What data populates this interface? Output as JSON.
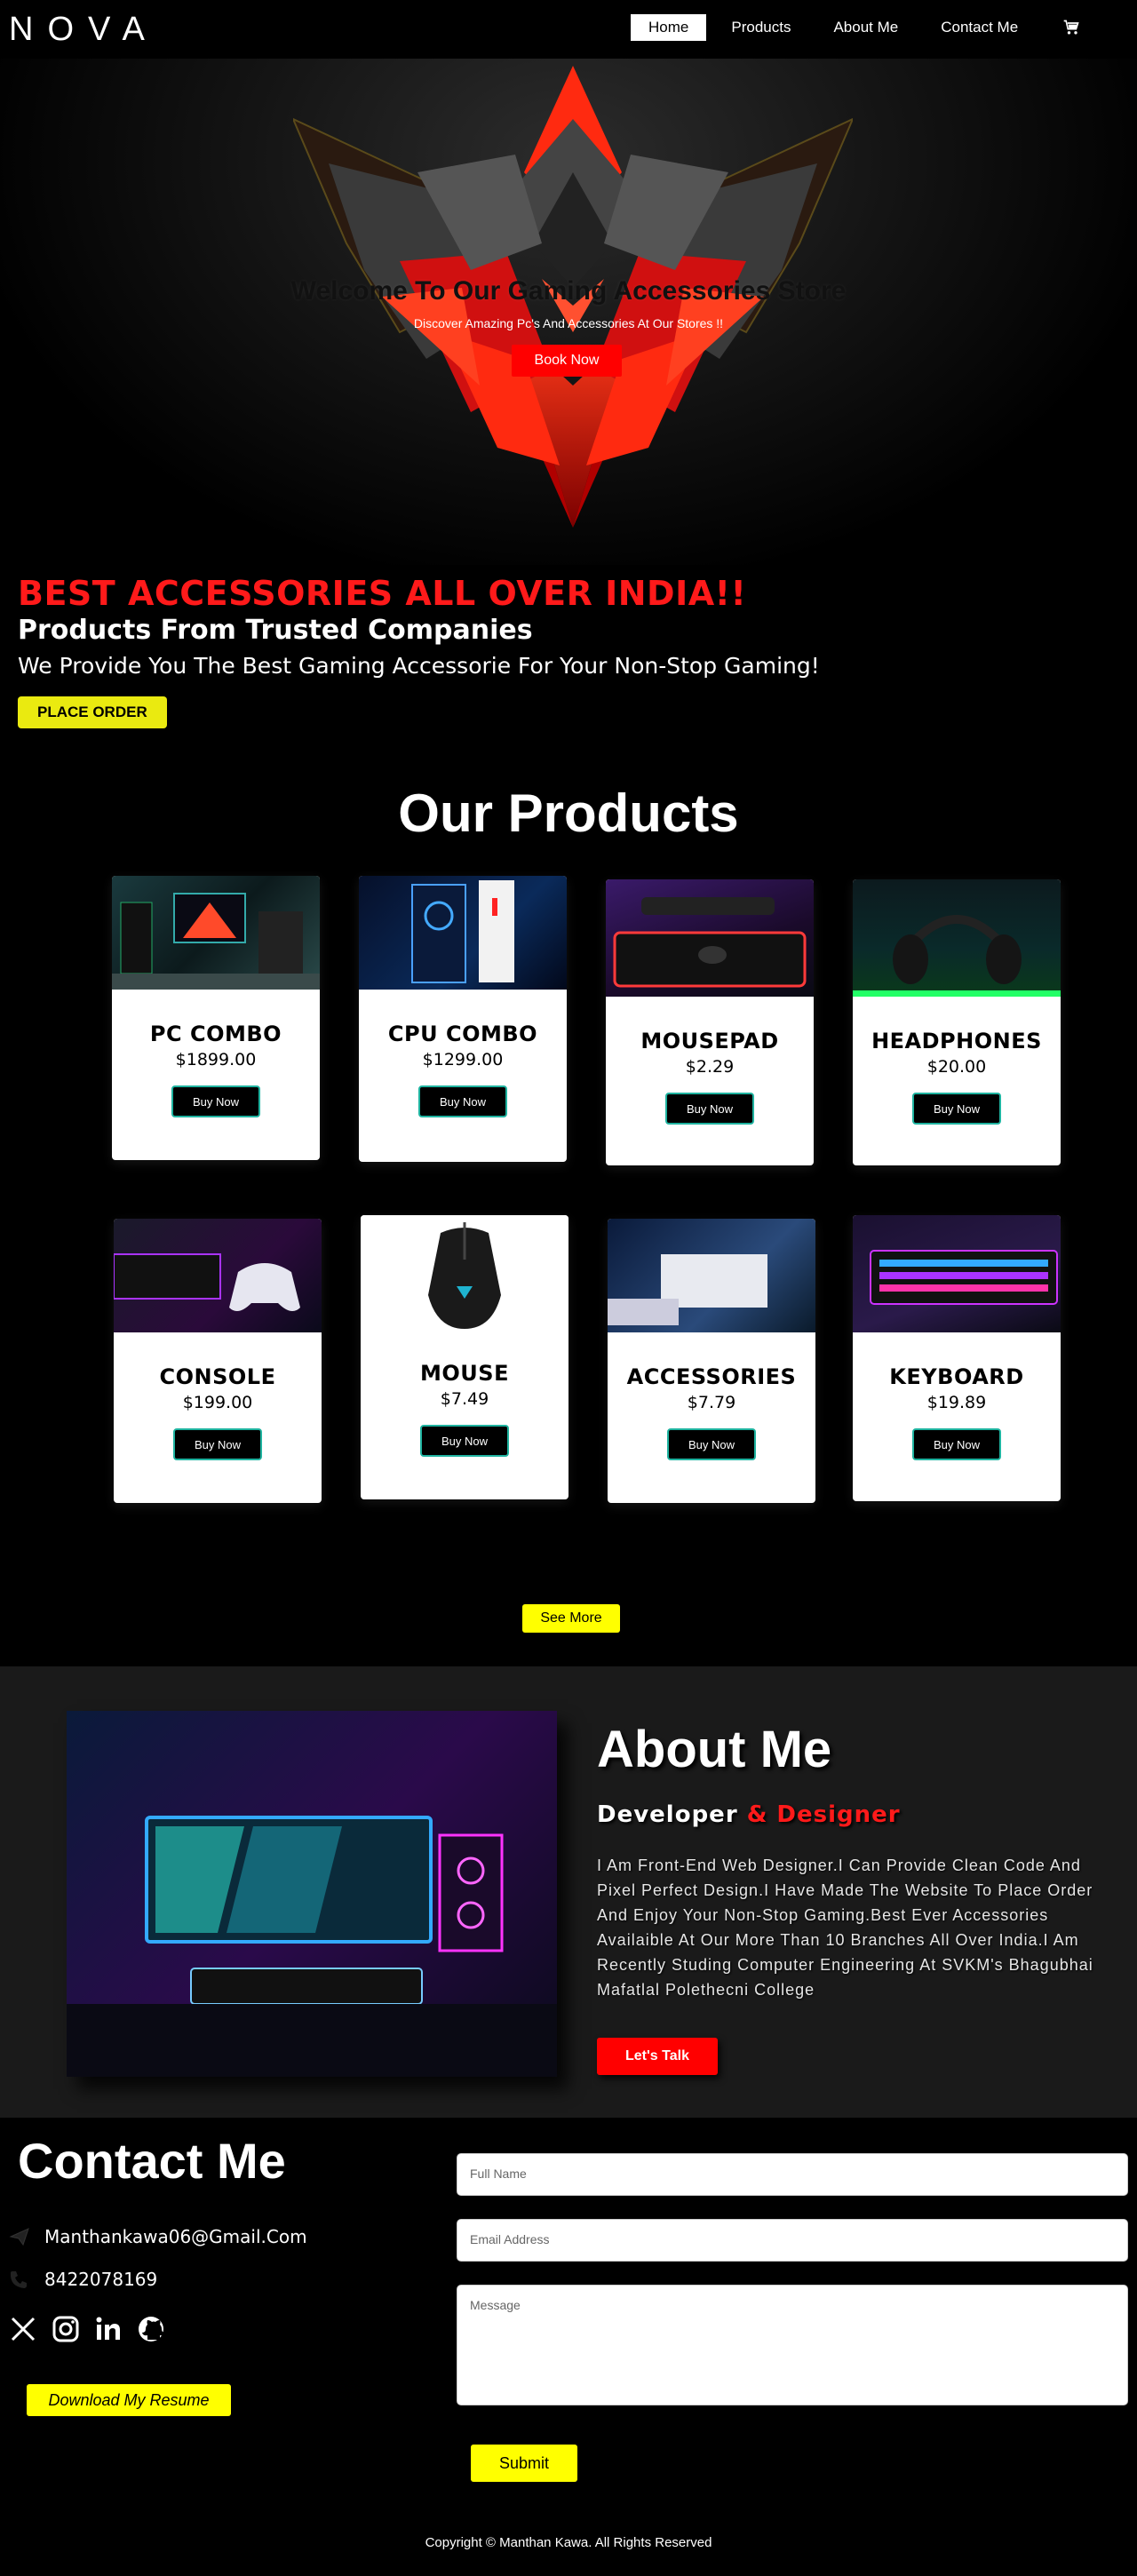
{
  "nav": {
    "logo": "NOVA",
    "links": [
      "Home",
      "Products",
      "About Me",
      "Contact Me"
    ],
    "active": "Home",
    "cart_icon": "cart-icon"
  },
  "hero": {
    "title": "Welcome To Our Gaming Accessories Store",
    "subtitle": "Discover Amazing Pc's And Accessories At Our Stores !!",
    "button": "Book Now"
  },
  "banner": {
    "headline": "BEST ACCESSORIES ALL OVER INDIA!!",
    "subheadline": "Products From Trusted Companies",
    "text": "We Provide You The Best Gaming Accessorie For Your Non-Stop Gaming!",
    "button": "PLACE ORDER"
  },
  "products": {
    "title": "Our Products",
    "items": [
      {
        "name": "PC COMBO",
        "price": "$1899.00",
        "button": "Buy Now"
      },
      {
        "name": "CPU COMBO",
        "price": "$1299.00",
        "button": "Buy Now"
      },
      {
        "name": "MOUSEPAD",
        "price": "$2.29",
        "button": "Buy Now"
      },
      {
        "name": "HEADPHONES",
        "price": "$20.00",
        "button": "Buy Now"
      },
      {
        "name": "CONSOLE",
        "price": "$199.00",
        "button": "Buy Now"
      },
      {
        "name": "MOUSE",
        "price": "$7.49",
        "button": "Buy Now"
      },
      {
        "name": "ACCESSORIES",
        "price": "$7.79",
        "button": "Buy Now"
      },
      {
        "name": "KEYBOARD",
        "price": "$19.89",
        "button": "Buy Now"
      }
    ],
    "see_more": "See More"
  },
  "about": {
    "title": "About Me",
    "role_part1": "Developer",
    "role_part2": "& Designer",
    "text": "I Am Front-End Web Designer.I Can Provide Clean Code And Pixel Perfect Design.I Have Made The Website To Place Order And Enjoy Your Non-Stop Gaming.Best Ever Accessories Availaible At Our More Than 10 Branches All Over India.I Am Recently Studing Computer Engineering At SVKM's Bhagubhai Mafatlal Polethecni College",
    "button": "Let's Talk"
  },
  "contact": {
    "title": "Contact Me",
    "email": "Manthankawa06@Gmail.Com",
    "phone": "8422078169",
    "socials": [
      "x-icon",
      "instagram-icon",
      "linkedin-icon",
      "github-icon"
    ],
    "resume_button": "Download My Resume",
    "form": {
      "name_placeholder": "Full Name",
      "email_placeholder": "Email Address",
      "message_placeholder": "Message",
      "submit": "Submit"
    }
  },
  "footer": {
    "text": "Copyright © Manthan Kawa. All Rights Reserved"
  },
  "colors": {
    "accent_red": "#ff1a1a",
    "accent_yellow": "#ffff00",
    "button_border_teal": "#1fb3a0"
  }
}
